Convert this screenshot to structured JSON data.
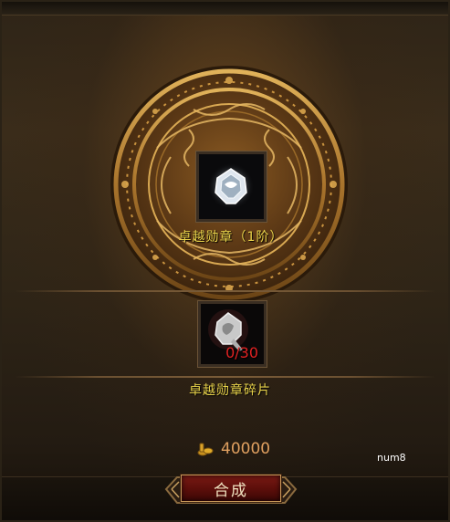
{
  "result_item": {
    "name": "卓越勋章（1阶）",
    "icon": "medal-icon"
  },
  "material_item": {
    "name": "卓越勋章碎片",
    "icon": "medal-fragment-icon",
    "count": "0/30"
  },
  "cost": {
    "icon": "gold-coin-icon",
    "value": "40000"
  },
  "corner_label": "num8",
  "buttons": {
    "synthesize": "合成"
  },
  "colors": {
    "item_name": "#e8d24a",
    "count_insufficient": "#e02222",
    "cost_value": "#e0a060",
    "button_red": "#7a1a14",
    "gold_trim": "#c89a5a"
  }
}
